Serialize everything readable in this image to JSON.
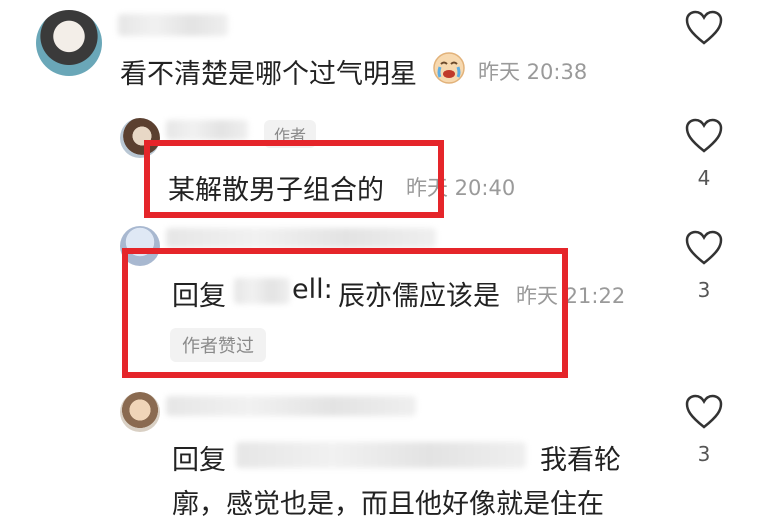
{
  "comments": [
    {
      "text": "看不清楚是哪个过气明星",
      "time": "昨天 20:38",
      "likes": ""
    },
    {
      "badge": "作者",
      "text": "某解散男子组合的",
      "time": "昨天 20:40",
      "likes": "4"
    },
    {
      "reply_prefix": "回复",
      "reply_target_suffix": "ell:",
      "text": "辰亦儒应该是",
      "time": "昨天 21:22",
      "liked_badge": "作者赞过",
      "likes": "3"
    },
    {
      "reply_prefix": "回复",
      "text_line1": "我看轮",
      "text_line2": "廓，感觉也是，而且他好像就是住在",
      "likes": "3"
    }
  ],
  "colors": {
    "highlight": "#e5252a",
    "meta_text": "#9a9a9a"
  },
  "icons": [
    "heart-icon",
    "crying-emoji-icon"
  ]
}
